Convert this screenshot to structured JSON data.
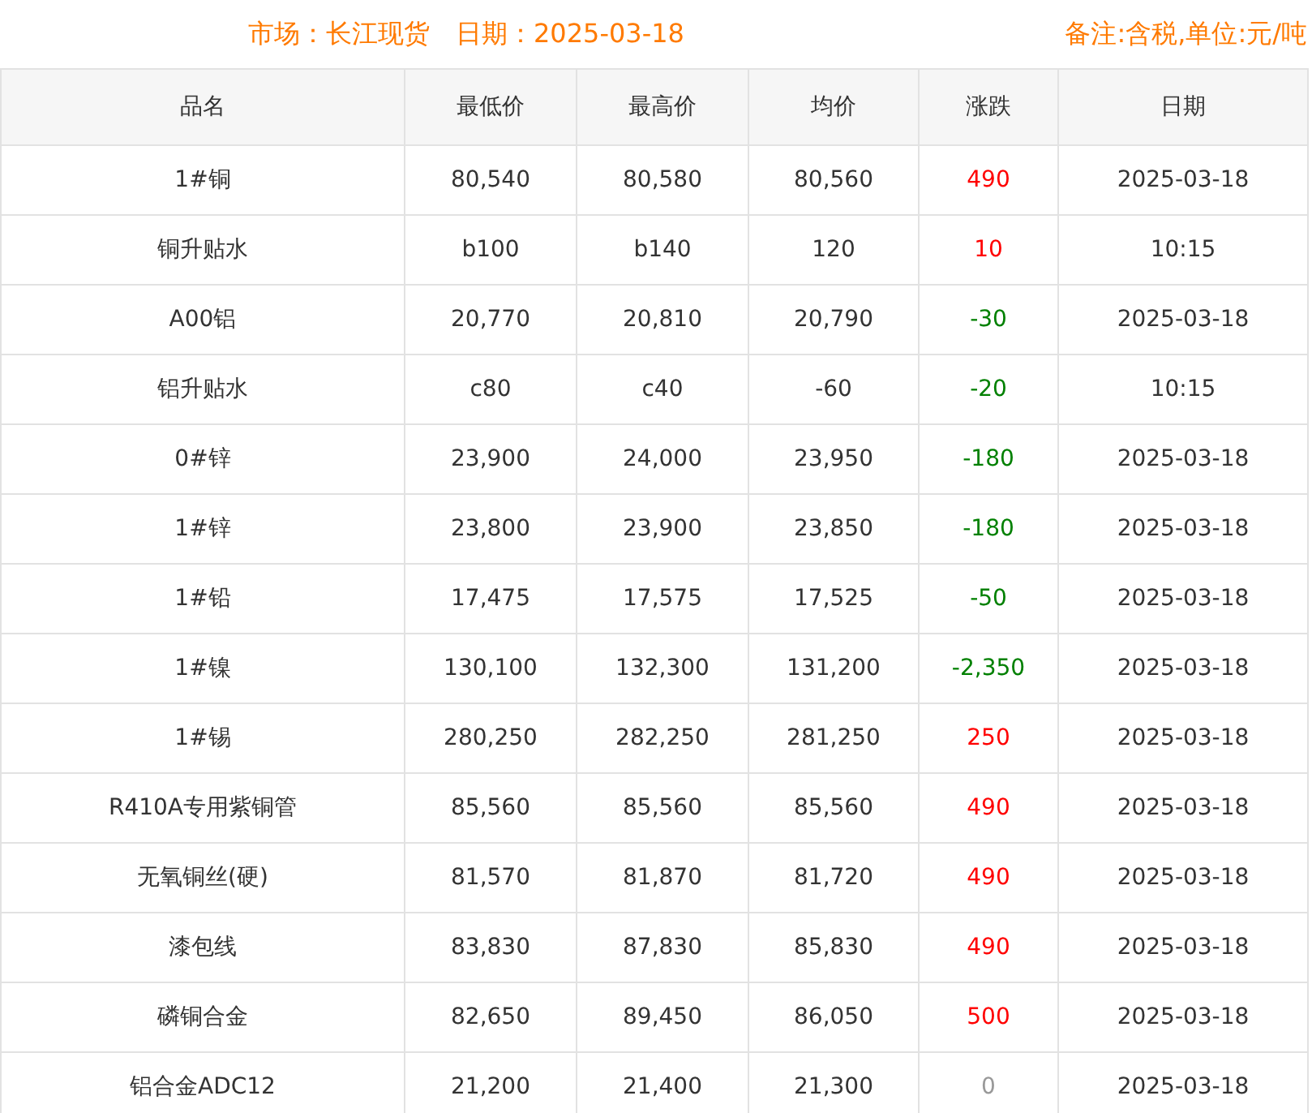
{
  "header": {
    "market": "市场：长江现货",
    "date": "日期：2025-03-18",
    "note": "备注:含税,单位:元/吨"
  },
  "table": {
    "columns": [
      "品名",
      "最低价",
      "最高价",
      "均价",
      "涨跌",
      "日期"
    ],
    "rows": [
      {
        "cells": [
          "1#铜",
          "80,540",
          "80,580",
          "80,560",
          "490",
          "2025-03-18"
        ],
        "color": "#ff0000"
      },
      {
        "cells": [
          "铜升贴水",
          "b100",
          "b140",
          "120",
          "10",
          "10:15"
        ],
        "color": "#ff0000"
      },
      {
        "cells": [
          "A00铝",
          "20,770",
          "20,810",
          "20,790",
          "-30",
          "2025-03-18"
        ],
        "color": "#008000"
      },
      {
        "cells": [
          "铝升贴水",
          "c80",
          "c40",
          "-60",
          "-20",
          "10:15"
        ],
        "color": "#008000"
      },
      {
        "cells": [
          "0#锌",
          "23,900",
          "24,000",
          "23,950",
          "-180",
          "2025-03-18"
        ],
        "color": "#008000"
      },
      {
        "cells": [
          "1#锌",
          "23,800",
          "23,900",
          "23,850",
          "-180",
          "2025-03-18"
        ],
        "color": "#008000"
      },
      {
        "cells": [
          "1#铅",
          "17,475",
          "17,575",
          "17,525",
          "-50",
          "2025-03-18"
        ],
        "color": "#008000"
      },
      {
        "cells": [
          "1#镍",
          "130,100",
          "132,300",
          "131,200",
          "-2,350",
          "2025-03-18"
        ],
        "color": "#008000"
      },
      {
        "cells": [
          "1#锡",
          "280,250",
          "282,250",
          "281,250",
          "250",
          "2025-03-18"
        ],
        "color": "#ff0000"
      },
      {
        "cells": [
          "R410A专用紫铜管",
          "85,560",
          "85,560",
          "85,560",
          "490",
          "2025-03-18"
        ],
        "color": "#ff0000"
      },
      {
        "cells": [
          "无氧铜丝(硬)",
          "81,570",
          "81,870",
          "81,720",
          "490",
          "2025-03-18"
        ],
        "color": "#ff0000"
      },
      {
        "cells": [
          "漆包线",
          "83,830",
          "87,830",
          "85,830",
          "490",
          "2025-03-18"
        ],
        "color": "#ff0000"
      },
      {
        "cells": [
          "磷铜合金",
          "82,650",
          "89,450",
          "86,050",
          "500",
          "2025-03-18"
        ],
        "color": "#ff0000"
      },
      {
        "cells": [
          "铝合金ADC12",
          "21,200",
          "21,400",
          "21,300",
          "0",
          "2025-03-18"
        ],
        "color": "#999999"
      }
    ]
  }
}
